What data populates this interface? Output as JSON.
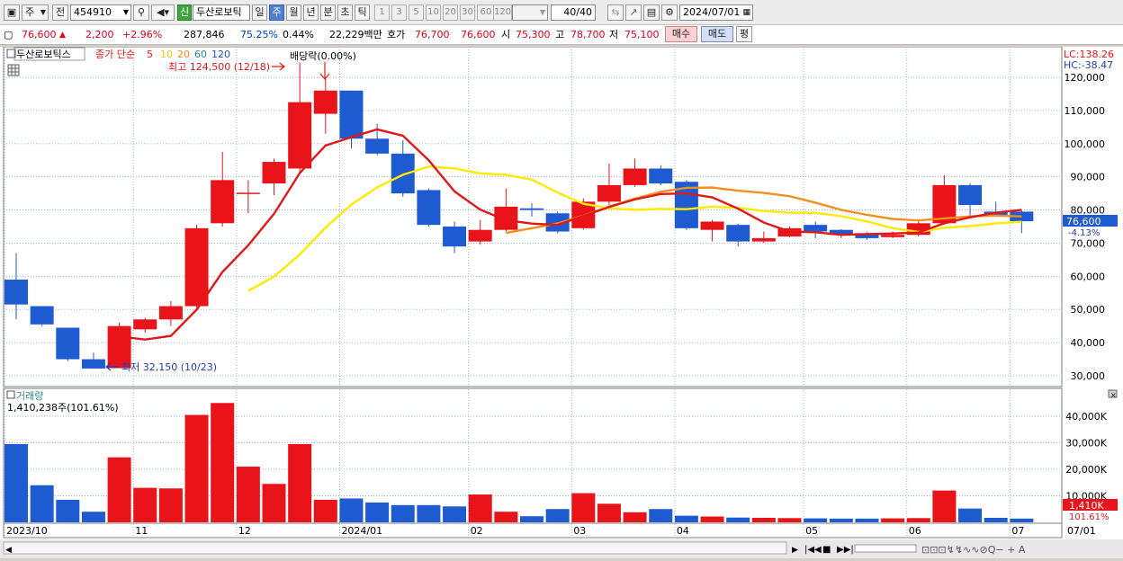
{
  "toolbar": {
    "period_label": "주",
    "prev_label": "전",
    "code": "454910",
    "stock_name": "두산로보틱",
    "credit_badge": "신",
    "tabs": [
      "일",
      "주",
      "월",
      "년",
      "분",
      "초",
      "틱"
    ],
    "active_tab": "주",
    "intervals": [
      "1",
      "3",
      "5",
      "10",
      "20",
      "30",
      "60",
      "120"
    ],
    "count": "40",
    "count_total": "/40",
    "date": "2024/07/01"
  },
  "quote": {
    "price": "76,600",
    "change": "2,200",
    "change_pct": "+2.96%",
    "volume": "287,846",
    "vol_ratio": "75.25%",
    "turnover": "0.44%",
    "amount": "22,229백만",
    "bid_label": "호가",
    "ask": "76,700",
    "bid": "76,600",
    "open_label": "시",
    "open": "75,300",
    "high_label": "고",
    "high": "78,700",
    "low_label": "저",
    "low": "75,100",
    "buy_label": "매수",
    "sell_label": "매도",
    "avg_label": "평"
  },
  "legend": {
    "stock": "두산로보틱스",
    "series_desc": "종가 단순",
    "ma_periods": [
      "5",
      "10",
      "20",
      "60",
      "120"
    ],
    "high_note": "최고 124,500 (12/18)",
    "dividend_note": "배당락(0.00%)",
    "low_note": "최저 32,150 (10/23)",
    "lc": "LC:138.26",
    "hc": "HC:-38.47",
    "last_price": "76,600",
    "last_pct": "-4.13%"
  },
  "volume_panel": {
    "title": "거래량",
    "value": "1,410,238주(101.61%)",
    "last_label": "1,410K",
    "last_pct": "101.61%"
  },
  "colors": {
    "up": "#e8141a",
    "down": "#1f5bd0",
    "ma5": "#e01818",
    "ma10": "#ffea00",
    "ma20": "#f09020",
    "grid": "#9bb5d6"
  },
  "chart_data": {
    "type": "candlestick",
    "price_axis": {
      "ticks": [
        "120,000",
        "110,000",
        "100,000",
        "90,000",
        "80,000",
        "70,000",
        "60,000",
        "50,000",
        "40,000",
        "30,000"
      ]
    },
    "volume_axis": {
      "ticks": [
        "40,000K",
        "30,000K",
        "20,000K",
        "10,000K"
      ]
    },
    "date_labels": [
      "2023/10",
      "11",
      "12",
      "2024/01",
      "02",
      "03",
      "04",
      "05",
      "06",
      "07",
      "07/01"
    ],
    "candles": [
      {
        "o": 59000,
        "c": 51500,
        "h": 67000,
        "l": 47000,
        "v": 29500
      },
      {
        "o": 51000,
        "c": 45500,
        "h": 51000,
        "l": 45000,
        "v": 14000
      },
      {
        "o": 44500,
        "c": 35000,
        "h": 44500,
        "l": 34500,
        "v": 8500
      },
      {
        "o": 35000,
        "c": 32200,
        "h": 37000,
        "l": 32150,
        "v": 4000
      },
      {
        "o": 32300,
        "c": 45000,
        "h": 46000,
        "l": 32300,
        "v": 24500
      },
      {
        "o": 44000,
        "c": 47000,
        "h": 47500,
        "l": 43000,
        "v": 13000
      },
      {
        "o": 47000,
        "c": 51000,
        "h": 52500,
        "l": 45000,
        "v": 12800
      },
      {
        "o": 51000,
        "c": 74500,
        "h": 75500,
        "l": 50500,
        "v": 40500
      },
      {
        "o": 76000,
        "c": 89000,
        "h": 97500,
        "l": 75000,
        "v": 45000
      },
      {
        "o": 85200,
        "c": 85200,
        "h": 89000,
        "l": 79000,
        "v": 21000
      },
      {
        "o": 88000,
        "c": 94500,
        "h": 95500,
        "l": 84500,
        "v": 14500
      },
      {
        "o": 92500,
        "c": 112500,
        "h": 124500,
        "l": 91500,
        "v": 29500
      },
      {
        "o": 109000,
        "c": 116000,
        "h": 119500,
        "l": 103000,
        "v": 8500
      },
      {
        "o": 116000,
        "c": 101500,
        "h": 116000,
        "l": 98500,
        "v": 9000
      },
      {
        "o": 101500,
        "c": 97000,
        "h": 106000,
        "l": 96500,
        "v": 7500
      },
      {
        "o": 97000,
        "c": 85000,
        "h": 101000,
        "l": 84000,
        "v": 6500
      },
      {
        "o": 86000,
        "c": 75500,
        "h": 86500,
        "l": 75000,
        "v": 6500
      },
      {
        "o": 75000,
        "c": 69000,
        "h": 76500,
        "l": 67000,
        "v": 6000
      },
      {
        "o": 70500,
        "c": 74000,
        "h": 77000,
        "l": 69500,
        "v": 10500
      },
      {
        "o": 74000,
        "c": 81000,
        "h": 86500,
        "l": 73500,
        "v": 4000
      },
      {
        "o": 80500,
        "c": 80000,
        "h": 82000,
        "l": 78000,
        "v": 2300
      },
      {
        "o": 79000,
        "c": 73500,
        "h": 79500,
        "l": 73000,
        "v": 5000
      },
      {
        "o": 74500,
        "c": 82500,
        "h": 83500,
        "l": 74000,
        "v": 11000
      },
      {
        "o": 82500,
        "c": 87500,
        "h": 94000,
        "l": 81500,
        "v": 7000
      },
      {
        "o": 87500,
        "c": 92500,
        "h": 95500,
        "l": 87000,
        "v": 3800
      },
      {
        "o": 92500,
        "c": 88000,
        "h": 93500,
        "l": 87500,
        "v": 5000
      },
      {
        "o": 88500,
        "c": 74500,
        "h": 89000,
        "l": 74000,
        "v": 2500
      },
      {
        "o": 74000,
        "c": 76500,
        "h": 77000,
        "l": 70500,
        "v": 2200
      },
      {
        "o": 75500,
        "c": 70500,
        "h": 75800,
        "l": 69000,
        "v": 1800
      },
      {
        "o": 70500,
        "c": 71500,
        "h": 73500,
        "l": 70000,
        "v": 1700
      },
      {
        "o": 72000,
        "c": 74500,
        "h": 75000,
        "l": 71800,
        "v": 1600
      },
      {
        "o": 75500,
        "c": 73500,
        "h": 76500,
        "l": 71500,
        "v": 1500
      },
      {
        "o": 74000,
        "c": 72500,
        "h": 74200,
        "l": 71500,
        "v": 1400
      },
      {
        "o": 73000,
        "c": 71500,
        "h": 73300,
        "l": 71000,
        "v": 1400
      },
      {
        "o": 71800,
        "c": 72500,
        "h": 73500,
        "l": 71500,
        "v": 1500
      },
      {
        "o": 72500,
        "c": 76000,
        "h": 77000,
        "l": 72000,
        "v": 1600
      },
      {
        "o": 76000,
        "c": 87500,
        "h": 90500,
        "l": 75500,
        "v": 12000
      },
      {
        "o": 87500,
        "c": 81500,
        "h": 88000,
        "l": 78000,
        "v": 5200
      },
      {
        "o": 79500,
        "c": 78500,
        "h": 82500,
        "l": 78000,
        "v": 1700
      },
      {
        "o": 79500,
        "c": 76600,
        "h": 80000,
        "l": 73000,
        "v": 1410
      }
    ]
  }
}
